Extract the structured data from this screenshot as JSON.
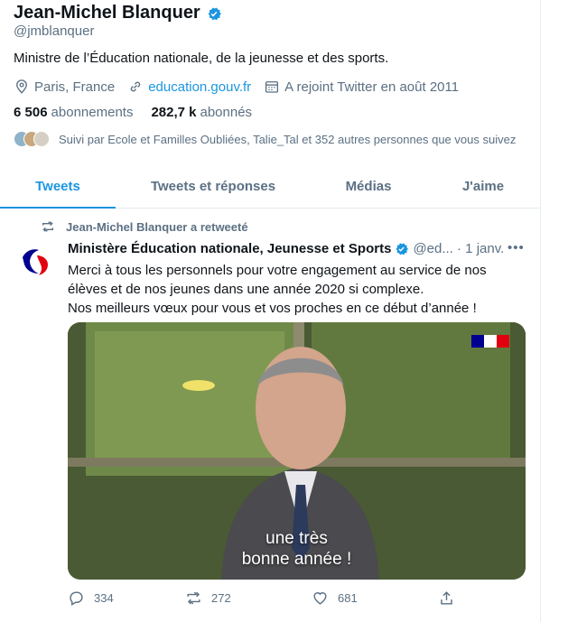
{
  "profile": {
    "name": "Jean-Michel Blanquer",
    "handle": "@jmblanquer",
    "bio": "Ministre de l’Éducation nationale, de la jeunesse et des sports.",
    "location": "Paris, France",
    "website": "education.gouv.fr",
    "joined": "A rejoint Twitter en août 2011",
    "following_count": "6 506",
    "following_label": "abonnements",
    "followers_count": "282,7 k",
    "followers_label": "abonnés",
    "followed_by": "Suivi par Ecole et Familles Oubliées, Talie_Tal et 352 autres personnes que vous suivez"
  },
  "tabs": [
    {
      "label": "Tweets",
      "active": true
    },
    {
      "label": "Tweets et réponses"
    },
    {
      "label": "Médias"
    },
    {
      "label": "J'aime"
    }
  ],
  "tweet": {
    "retweet_notice": "Jean-Michel Blanquer a retweeté",
    "author": "Ministère Éducation nationale, Jeunesse et Sports",
    "handle_time": "@ed... · 1 janv.",
    "more": "•••",
    "text_line1": "Merci à tous les personnels pour votre engagement au service de nos élèves et de nos jeunes dans une année 2020 si complexe.",
    "text_line2": "Nos meilleurs vœux pour vous et vos proches en ce début d’année !",
    "caption_line1": "une très",
    "caption_line2": "bonne année !",
    "replies": "334",
    "retweets": "272",
    "likes": "681"
  },
  "colors": {
    "accent": "#1b95e0",
    "muted": "#5b7083",
    "text": "#0f1419"
  }
}
